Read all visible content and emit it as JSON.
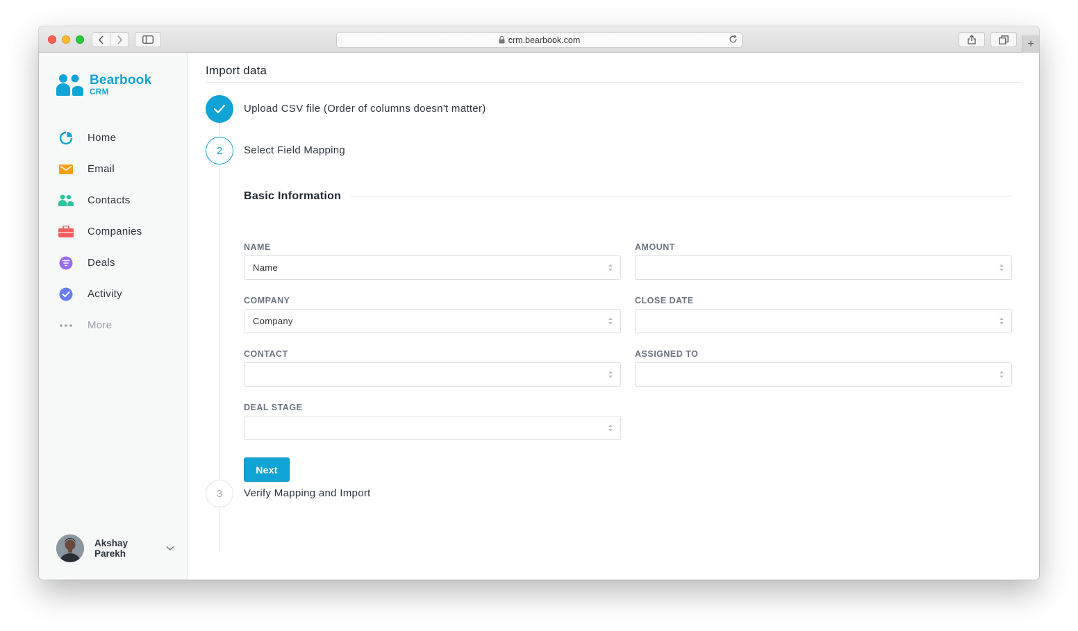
{
  "browser": {
    "url": "crm.bearbook.com"
  },
  "brand": {
    "name": "Bearbook",
    "sub": "CRM",
    "color": "#10a3d6"
  },
  "sidebar": {
    "items": [
      {
        "label": "Home",
        "icon": "pie-chart-icon",
        "color": "#10a3d6"
      },
      {
        "label": "Email",
        "icon": "envelope-icon",
        "color": "#f59f0b"
      },
      {
        "label": "Contacts",
        "icon": "people-icon",
        "color": "#2ec4a0"
      },
      {
        "label": "Companies",
        "icon": "briefcase-icon",
        "color": "#f25c5c"
      },
      {
        "label": "Deals",
        "icon": "funnel-icon",
        "color": "#9b6cf0"
      },
      {
        "label": "Activity",
        "icon": "check-circle-icon",
        "color": "#6b7df0"
      },
      {
        "label": "More",
        "icon": "more-dots-icon",
        "color": "#9aa0a6"
      }
    ]
  },
  "user": {
    "first_name": "Akshay",
    "last_name": "Parekh"
  },
  "page": {
    "title": "Import data"
  },
  "steps": [
    {
      "number": "1",
      "label": "Upload CSV file (Order of columns doesn't matter)",
      "status": "complete"
    },
    {
      "number": "2",
      "label": "Select Field Mapping",
      "status": "active"
    },
    {
      "number": "3",
      "label": "Verify Mapping and Import",
      "status": "pending"
    }
  ],
  "mapping": {
    "section_title": "Basic Information",
    "fields": {
      "name": {
        "label": "NAME",
        "value": "Name"
      },
      "amount": {
        "label": "AMOUNT",
        "value": ""
      },
      "company": {
        "label": "COMPANY",
        "value": "Company"
      },
      "close_date": {
        "label": "CLOSE DATE",
        "value": ""
      },
      "contact": {
        "label": "CONTACT",
        "value": ""
      },
      "assigned_to": {
        "label": "ASSIGNED TO",
        "value": ""
      },
      "deal_stage": {
        "label": "DEAL STAGE",
        "value": ""
      }
    },
    "next_label": "Next"
  }
}
